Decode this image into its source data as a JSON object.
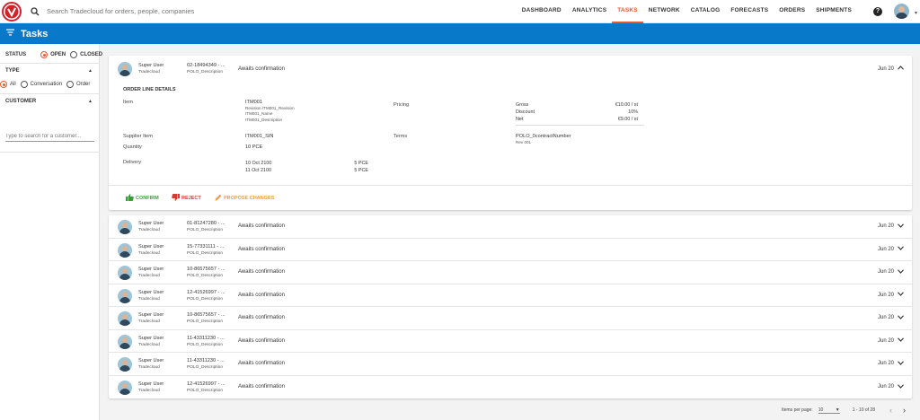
{
  "search": {
    "placeholder": "Search Tradecloud for orders, people, companies"
  },
  "nav": [
    "DASHBOARD",
    "ANALYTICS",
    "TASKS",
    "NETWORK",
    "CATALOG",
    "FORECASTS",
    "ORDERS",
    "SHIPMENTS"
  ],
  "nav_active": "TASKS",
  "help_glyph": "?",
  "page_title": "Tasks",
  "sidebar": {
    "status_title": "STATUS",
    "status_open": "OPEN",
    "status_closed": "CLOSED",
    "type_title": "TYPE",
    "type_all": "All",
    "type_conversation": "Conversation",
    "type_order": "Order",
    "customer_title": "CUSTOMER",
    "customer_placeholder": "Type to search for a customer..."
  },
  "expanded": {
    "user": "Super User",
    "company": "Tradecloud",
    "order": "02-18494349 - ...",
    "description": "POLO_Description",
    "status": "Awaits confirmation",
    "date": "Jun 20",
    "heading": "ORDER LINE DETAILS",
    "item_label": "Item",
    "item_code": "ITM001",
    "item_revision": "Revision ITM001_Revision",
    "item_name": "ITM001_Name",
    "item_desc": "ITM001_Description",
    "pricing_label": "Pricing",
    "gross_label": "Gross",
    "gross_value": "€10.00 / st",
    "discount_label": "Discount",
    "discount_value": "10%",
    "net_label": "Net",
    "net_value": "€9.00 / st",
    "supplier_item_label": "Supplier Item",
    "supplier_item_value": "ITM001_SIN",
    "quantity_label": "Quantity",
    "quantity_value": "10 PCE",
    "terms_label": "Terms",
    "terms_contract": "POLO_0contractNumber",
    "terms_rev": "Rev 001",
    "delivery_label": "Delivery",
    "delivery": [
      {
        "date": "10 Oct 2100",
        "qty": "5 PCE"
      },
      {
        "date": "11 Oct 2100",
        "qty": "5 PCE"
      }
    ],
    "confirm": "CONFIRM",
    "reject": "REJECT",
    "propose": "PROPOSE CHANGES"
  },
  "tasks": [
    {
      "user": "Super User",
      "company": "Tradecloud",
      "order": "01-81247280 - ...",
      "description": "POLO_Description",
      "status": "Awaits confirmation",
      "date": "Jun 20"
    },
    {
      "user": "Super User",
      "company": "Tradecloud",
      "order": "15-77331111 - ...",
      "description": "POLO_Description",
      "status": "Awaits confirmation",
      "date": "Jun 20"
    },
    {
      "user": "Super User",
      "company": "Tradecloud",
      "order": "10-86575657 - ...",
      "description": "POLO_Description",
      "status": "Awaits confirmation",
      "date": "Jun 20"
    },
    {
      "user": "Super User",
      "company": "Tradecloud",
      "order": "12-41526997 - ...",
      "description": "POLO_Description",
      "status": "Awaits confirmation",
      "date": "Jun 20"
    },
    {
      "user": "Super User",
      "company": "Tradecloud",
      "order": "10-86575657 - ...",
      "description": "POLO_Description",
      "status": "Awaits confirmation",
      "date": "Jun 20"
    },
    {
      "user": "Super User",
      "company": "Tradecloud",
      "order": "11-43311230 - ...",
      "description": "POLO_Description",
      "status": "Awaits confirmation",
      "date": "Jun 20"
    },
    {
      "user": "Super User",
      "company": "Tradecloud",
      "order": "11-43311230 - ...",
      "description": "POLO_Description",
      "status": "Awaits confirmation",
      "date": "Jun 20"
    },
    {
      "user": "Super User",
      "company": "Tradecloud",
      "order": "12-41526997 - ...",
      "description": "POLO_Description",
      "status": "Awaits confirmation",
      "date": "Jun 20"
    }
  ],
  "pager": {
    "items_label": "Items per page:",
    "items_value": "10",
    "range": "1 - 10 of 28"
  },
  "colors": {
    "accent": "#e8582b",
    "header_blue": "#0878c8",
    "confirm": "#3a9c3a",
    "reject": "#d83a2c",
    "propose": "#f0a030"
  },
  "icons": [
    "tradecloud-logo",
    "search-icon",
    "help-icon",
    "filter-icon",
    "thumb-up-icon",
    "thumb-down-icon",
    "pencil-icon",
    "chevron-down-icon",
    "chevron-up-icon",
    "chevron-left-icon",
    "chevron-right-icon"
  ]
}
